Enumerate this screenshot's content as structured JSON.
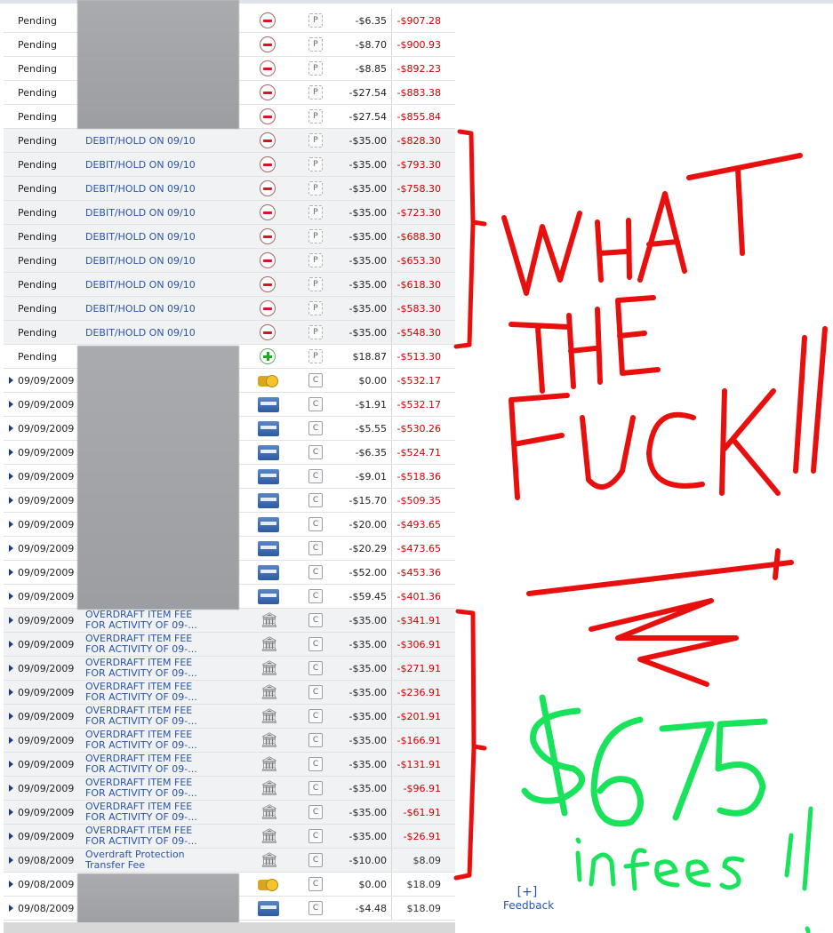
{
  "pending_rows": [
    {
      "status": "Pending",
      "desc": "",
      "amount": "-$6.35",
      "balance": "-$907.28",
      "icon": "minus-icon"
    },
    {
      "status": "Pending",
      "desc": "",
      "amount": "-$8.70",
      "balance": "-$900.93",
      "icon": "minus-icon"
    },
    {
      "status": "Pending",
      "desc": "",
      "amount": "-$8.85",
      "balance": "-$892.23",
      "icon": "minus-icon"
    },
    {
      "status": "Pending",
      "desc": "",
      "amount": "-$27.54",
      "balance": "-$883.38",
      "icon": "minus-icon"
    },
    {
      "status": "Pending",
      "desc": "",
      "amount": "-$27.54",
      "balance": "-$855.84",
      "icon": "minus-icon"
    },
    {
      "status": "Pending",
      "desc": "DEBIT/HOLD ON 09/10",
      "amount": "-$35.00",
      "balance": "-$828.30",
      "icon": "minus-icon"
    },
    {
      "status": "Pending",
      "desc": "DEBIT/HOLD ON 09/10",
      "amount": "-$35.00",
      "balance": "-$793.30",
      "icon": "minus-icon"
    },
    {
      "status": "Pending",
      "desc": "DEBIT/HOLD ON 09/10",
      "amount": "-$35.00",
      "balance": "-$758.30",
      "icon": "minus-icon"
    },
    {
      "status": "Pending",
      "desc": "DEBIT/HOLD ON 09/10",
      "amount": "-$35.00",
      "balance": "-$723.30",
      "icon": "minus-icon"
    },
    {
      "status": "Pending",
      "desc": "DEBIT/HOLD ON 09/10",
      "amount": "-$35.00",
      "balance": "-$688.30",
      "icon": "minus-icon"
    },
    {
      "status": "Pending",
      "desc": "DEBIT/HOLD ON 09/10",
      "amount": "-$35.00",
      "balance": "-$653.30",
      "icon": "minus-icon"
    },
    {
      "status": "Pending",
      "desc": "DEBIT/HOLD ON 09/10",
      "amount": "-$35.00",
      "balance": "-$618.30",
      "icon": "minus-icon"
    },
    {
      "status": "Pending",
      "desc": "DEBIT/HOLD ON 09/10",
      "amount": "-$35.00",
      "balance": "-$583.30",
      "icon": "minus-icon"
    },
    {
      "status": "Pending",
      "desc": "DEBIT/HOLD ON 09/10",
      "amount": "-$35.00",
      "balance": "-$548.30",
      "icon": "minus-icon"
    },
    {
      "status": "Pending",
      "desc": "",
      "amount": "$18.87",
      "balance": "-$513.30",
      "icon": "plus-icon"
    }
  ],
  "pending_status_code": "P",
  "cleared_status_code": "C",
  "posted_rows": [
    {
      "date": "09/09/2009",
      "desc": "",
      "amount": "$0.00",
      "balance": "-$532.17",
      "icon": "coins-icon"
    },
    {
      "date": "09/09/2009",
      "desc": "",
      "amount": "-$1.91",
      "balance": "-$532.17",
      "icon": "card-icon"
    },
    {
      "date": "09/09/2009",
      "desc": "",
      "amount": "-$5.55",
      "balance": "-$530.26",
      "icon": "card-icon"
    },
    {
      "date": "09/09/2009",
      "desc": "",
      "amount": "-$6.35",
      "balance": "-$524.71",
      "icon": "card-icon"
    },
    {
      "date": "09/09/2009",
      "desc": "",
      "amount": "-$9.01",
      "balance": "-$518.36",
      "icon": "card-icon"
    },
    {
      "date": "09/09/2009",
      "desc": "",
      "amount": "-$15.70",
      "balance": "-$509.35",
      "icon": "card-icon"
    },
    {
      "date": "09/09/2009",
      "desc": "",
      "amount": "-$20.00",
      "balance": "-$493.65",
      "icon": "card-icon"
    },
    {
      "date": "09/09/2009",
      "desc": "",
      "amount": "-$20.29",
      "balance": "-$473.65",
      "icon": "card-icon"
    },
    {
      "date": "09/09/2009",
      "desc": "",
      "amount": "-$52.00",
      "balance": "-$453.36",
      "icon": "card-icon"
    },
    {
      "date": "09/09/2009",
      "desc": "",
      "amount": "-$59.45",
      "balance": "-$401.36",
      "icon": "card-icon"
    },
    {
      "date": "09/09/2009",
      "desc": "OVERDRAFT ITEM FEE\nFOR ACTIVITY OF 09-...",
      "amount": "-$35.00",
      "balance": "-$341.91",
      "icon": "bank-icon"
    },
    {
      "date": "09/09/2009",
      "desc": "OVERDRAFT ITEM FEE\nFOR ACTIVITY OF 09-...",
      "amount": "-$35.00",
      "balance": "-$306.91",
      "icon": "bank-icon"
    },
    {
      "date": "09/09/2009",
      "desc": "OVERDRAFT ITEM FEE\nFOR ACTIVITY OF 09-...",
      "amount": "-$35.00",
      "balance": "-$271.91",
      "icon": "bank-icon"
    },
    {
      "date": "09/09/2009",
      "desc": "OVERDRAFT ITEM FEE\nFOR ACTIVITY OF 09-...",
      "amount": "-$35.00",
      "balance": "-$236.91",
      "icon": "bank-icon"
    },
    {
      "date": "09/09/2009",
      "desc": "OVERDRAFT ITEM FEE\nFOR ACTIVITY OF 09-...",
      "amount": "-$35.00",
      "balance": "-$201.91",
      "icon": "bank-icon"
    },
    {
      "date": "09/09/2009",
      "desc": "OVERDRAFT ITEM FEE\nFOR ACTIVITY OF 09-...",
      "amount": "-$35.00",
      "balance": "-$166.91",
      "icon": "bank-icon"
    },
    {
      "date": "09/09/2009",
      "desc": "OVERDRAFT ITEM FEE\nFOR ACTIVITY OF 09-...",
      "amount": "-$35.00",
      "balance": "-$131.91",
      "icon": "bank-icon"
    },
    {
      "date": "09/09/2009",
      "desc": "OVERDRAFT ITEM FEE\nFOR ACTIVITY OF 09-...",
      "amount": "-$35.00",
      "balance": "-$96.91",
      "icon": "bank-icon"
    },
    {
      "date": "09/09/2009",
      "desc": "OVERDRAFT ITEM FEE\nFOR ACTIVITY OF 09-...",
      "amount": "-$35.00",
      "balance": "-$61.91",
      "icon": "bank-icon"
    },
    {
      "date": "09/09/2009",
      "desc": "OVERDRAFT ITEM FEE\nFOR ACTIVITY OF 09-...",
      "amount": "-$35.00",
      "balance": "-$26.91",
      "icon": "bank-icon"
    },
    {
      "date": "09/08/2009",
      "desc": "Overdraft Protection\nTransfer Fee",
      "amount": "-$10.00",
      "balance": "$8.09",
      "icon": "bank-icon"
    },
    {
      "date": "09/08/2009",
      "desc": "",
      "amount": "$0.00",
      "balance": "$18.09",
      "icon": "coins-icon"
    },
    {
      "date": "09/08/2009",
      "desc": "",
      "amount": "-$4.48",
      "balance": "$18.09",
      "icon": "card-icon"
    }
  ],
  "feedback": {
    "plus": "[+]",
    "label": "Feedback"
  },
  "annotation": {
    "line1": "WHAT",
    "line2": "THE",
    "line3": "FUCK!!",
    "amount": "$675",
    "suffix": "in fees !!",
    "red": "#e8100e",
    "green": "#19e35a"
  }
}
